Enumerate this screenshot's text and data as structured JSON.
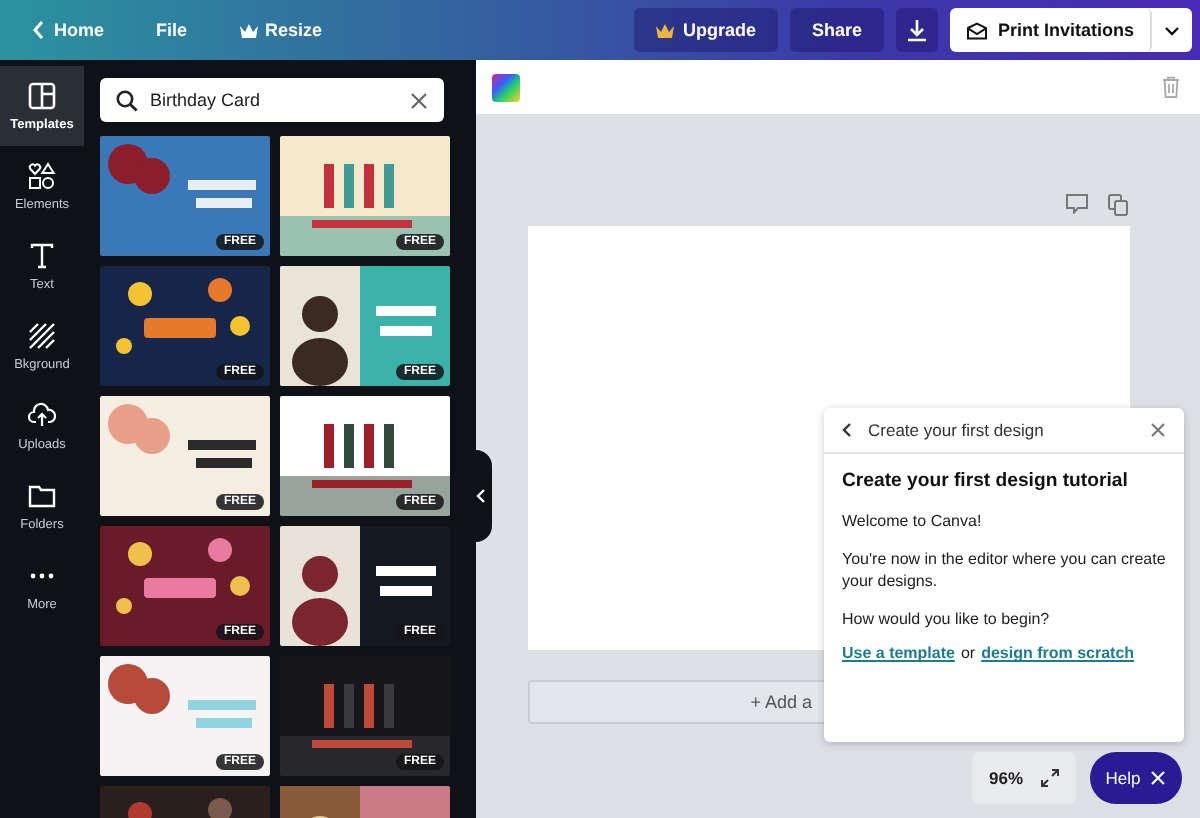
{
  "topbar": {
    "back": "Home",
    "menu": [
      {
        "label": "File",
        "kind": "plain"
      },
      {
        "label": "Resize",
        "kind": "crown"
      }
    ],
    "upgrade": "Upgrade",
    "share": "Share",
    "print": "Print Invitations"
  },
  "rail": [
    {
      "label": "Templates",
      "kind": "templates",
      "selected": true
    },
    {
      "label": "Elements",
      "kind": "elements",
      "selected": false
    },
    {
      "label": "Text",
      "kind": "text",
      "selected": false
    },
    {
      "label": "Bkground",
      "kind": "background",
      "selected": false
    },
    {
      "label": "Uploads",
      "kind": "uploads",
      "selected": false
    },
    {
      "label": "Folders",
      "kind": "folders",
      "selected": false
    },
    {
      "label": "More",
      "kind": "more",
      "selected": false
    }
  ],
  "search": {
    "value": "Birthday Card"
  },
  "templates": [
    {
      "kind": "picture",
      "badge": "FREE"
    },
    {
      "kind": "picture",
      "badge": "FREE"
    },
    {
      "kind": "picture",
      "badge": "FREE"
    },
    {
      "kind": "picture",
      "badge": "FREE"
    },
    {
      "kind": "picture",
      "badge": "FREE"
    },
    {
      "kind": "picture",
      "badge": "FREE"
    },
    {
      "kind": "picture",
      "badge": "FREE"
    },
    {
      "kind": "picture",
      "badge": "FREE"
    },
    {
      "kind": "picture",
      "badge": "FREE"
    },
    {
      "kind": "picture",
      "badge": "FREE"
    },
    {
      "kind": "picture"
    },
    {
      "kind": "picture"
    }
  ],
  "editor": {
    "add_page": "+ Add a",
    "zoom": "96%",
    "help": "Help"
  },
  "tutorial": {
    "header": "Create your first design",
    "title": "Create your first design tutorial",
    "paragraphs": [
      "Welcome to Canva!",
      "You're now in the editor where you can create your designs.",
      "How would you like to begin?"
    ],
    "actions": [
      {
        "kind": "link",
        "text": "Use a template"
      },
      {
        "kind": "text",
        "text": "or"
      },
      {
        "kind": "link",
        "text": "design from scratch"
      }
    ]
  }
}
